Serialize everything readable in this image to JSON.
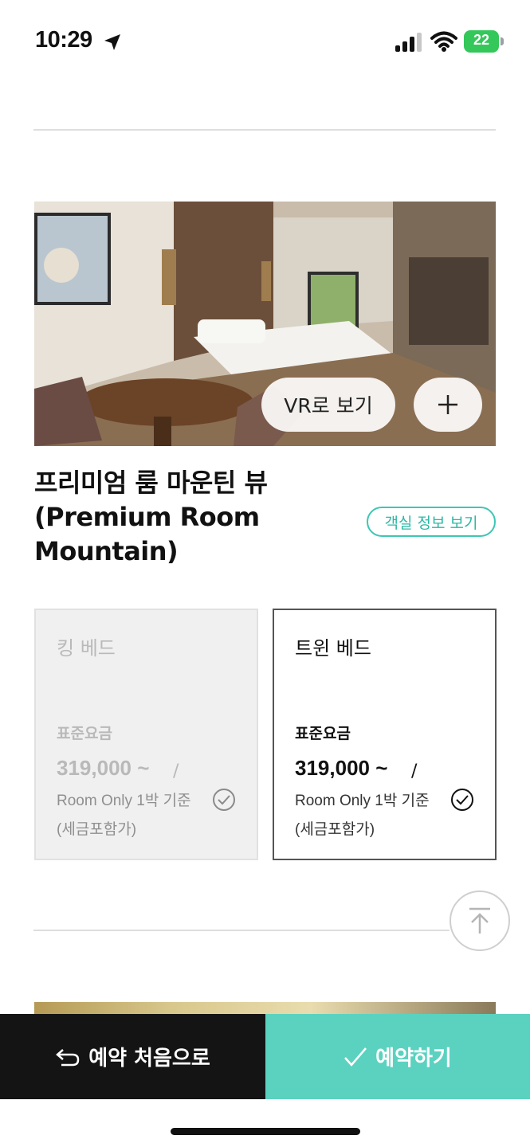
{
  "status_bar": {
    "time": "10:29",
    "battery": "22",
    "location_icon": "location-arrow-icon",
    "signal_icon": "cellular-signal-icon",
    "wifi_icon": "wifi-icon",
    "battery_color": "#34c759"
  },
  "room": {
    "title": "프리미엄 룸 마운틴 뷰 (Premium Room Mountain)",
    "vr_label": "VR로 보기",
    "plus_icon": "plus-icon",
    "info_label": "객실 정보 보기"
  },
  "bed_options": [
    {
      "name": "킹 베드",
      "rate_label": "표준요금",
      "price": "319,000 ~",
      "slash": "/",
      "note": "Room Only 1박 기준 (세금포함가)",
      "state": "disabled"
    },
    {
      "name": "트윈 베드",
      "rate_label": "표준요금",
      "price": "319,000 ~",
      "slash": "/",
      "note": "Room Only 1박 기준 (세금포함가)",
      "state": "selected"
    }
  ],
  "scroll_top_icon": "arrow-up-to-top-icon",
  "bottom_bar": {
    "restart_label": "예약 처음으로",
    "restart_icon": "undo-arrow-icon",
    "reserve_label": "예약하기",
    "reserve_icon": "checkmark-icon"
  },
  "colors": {
    "accent": "#5bd2c0",
    "accent_text": "#2bb8a4",
    "dark": "#141414"
  }
}
